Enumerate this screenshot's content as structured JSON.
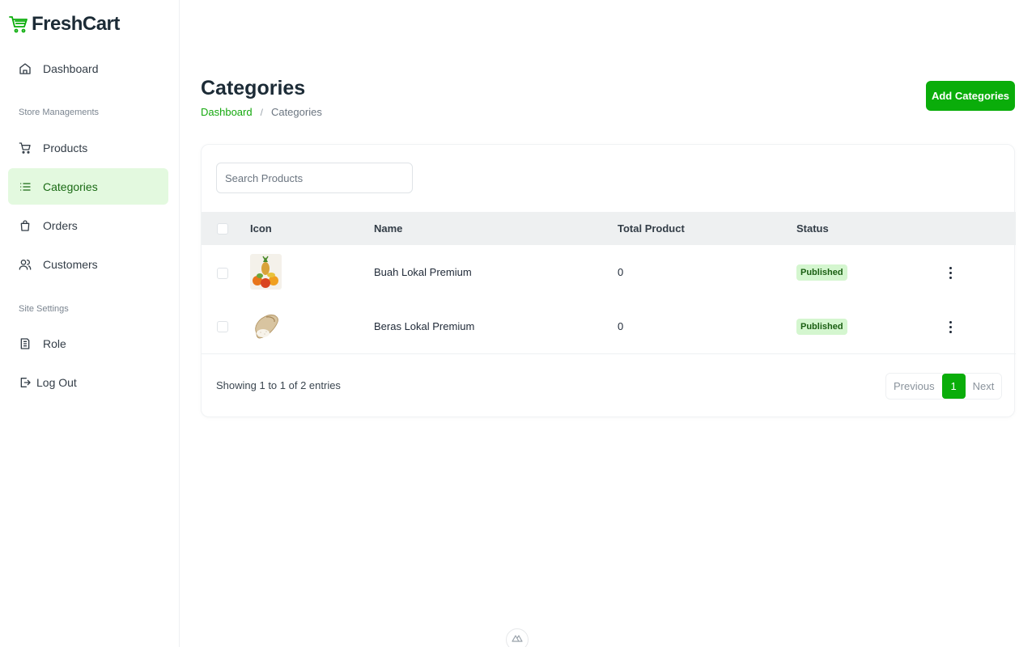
{
  "brand": {
    "name": "FreshCart",
    "accent": "#0aad0a"
  },
  "sidebar": {
    "items": [
      {
        "label": "Dashboard",
        "icon": "home-icon"
      },
      {
        "label": "Products",
        "icon": "cart-icon"
      },
      {
        "label": "Categories",
        "icon": "list-icon",
        "active": true
      },
      {
        "label": "Orders",
        "icon": "shopping-bag-icon"
      },
      {
        "label": "Customers",
        "icon": "users-icon"
      },
      {
        "label": "Role",
        "icon": "document-icon"
      },
      {
        "label": "Log Out",
        "icon": "logout-icon"
      }
    ],
    "sections": {
      "store": "Store Managements",
      "site": "Site Settings"
    }
  },
  "header": {
    "title": "Categories",
    "breadcrumb": {
      "link": "Dashboard",
      "separator": "/",
      "current": "Categories"
    },
    "add_button": "Add Categories"
  },
  "search": {
    "placeholder": "Search Products",
    "value": ""
  },
  "table": {
    "columns": [
      "Icon",
      "Name",
      "Total Product",
      "Status"
    ],
    "rows": [
      {
        "icon": "fruit-basket-image",
        "name": "Buah Lokal Premium",
        "total": "0",
        "status": "Published"
      },
      {
        "icon": "rice-sack-image",
        "name": "Beras Lokal Premium",
        "total": "0",
        "status": "Published"
      }
    ]
  },
  "footer": {
    "showing": "Showing 1 to 1 of 2 entries",
    "pagination": {
      "previous": "Previous",
      "current": "1",
      "next": "Next"
    }
  }
}
